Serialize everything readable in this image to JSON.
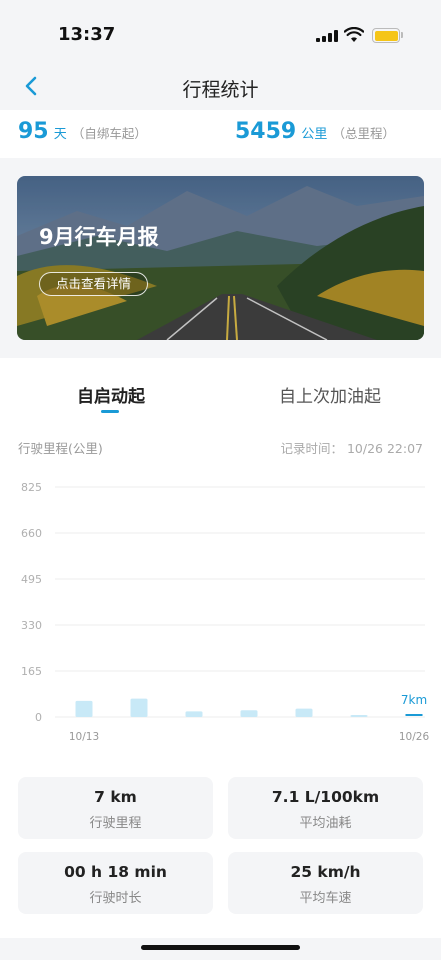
{
  "status_bar": {
    "time": "13:37"
  },
  "nav": {
    "title": "行程统计"
  },
  "summary": {
    "days": {
      "value": "95",
      "unit": "天",
      "note": "（自绑车起）"
    },
    "mileage": {
      "value": "5459",
      "unit": "公里",
      "note": "（总里程）"
    }
  },
  "banner": {
    "title": "9月行车月报",
    "button": "点击查看详情"
  },
  "tabs": [
    {
      "label": "自启动起",
      "active": true
    },
    {
      "label": "自上次加油起",
      "active": false
    }
  ],
  "section": {
    "label": "行驶里程(公里)",
    "record_time": "记录时间：  10/26 22:07"
  },
  "chart_data": {
    "type": "bar",
    "ylabel": "行驶里程(公里)",
    "yticks": [
      "825",
      "660",
      "495",
      "330",
      "165",
      "0"
    ],
    "ylim": [
      0,
      825
    ],
    "x_labels": [
      "10/13",
      "10/26"
    ],
    "values": [
      58,
      66,
      20,
      24,
      30,
      7,
      7
    ],
    "last_value_label": "7km",
    "colors": {
      "bar": "#c8e9f7",
      "last_bar": "#1a9ad6",
      "grid": "#eeeeee"
    }
  },
  "stats": [
    {
      "value": "7 km",
      "label": "行驶里程"
    },
    {
      "value": "7.1 L/100km",
      "label": "平均油耗"
    },
    {
      "value": "00 h 18 min",
      "label": "行驶时长"
    },
    {
      "value": "25 km/h",
      "label": "平均车速"
    }
  ],
  "colors": {
    "accent": "#1a9ad6"
  }
}
